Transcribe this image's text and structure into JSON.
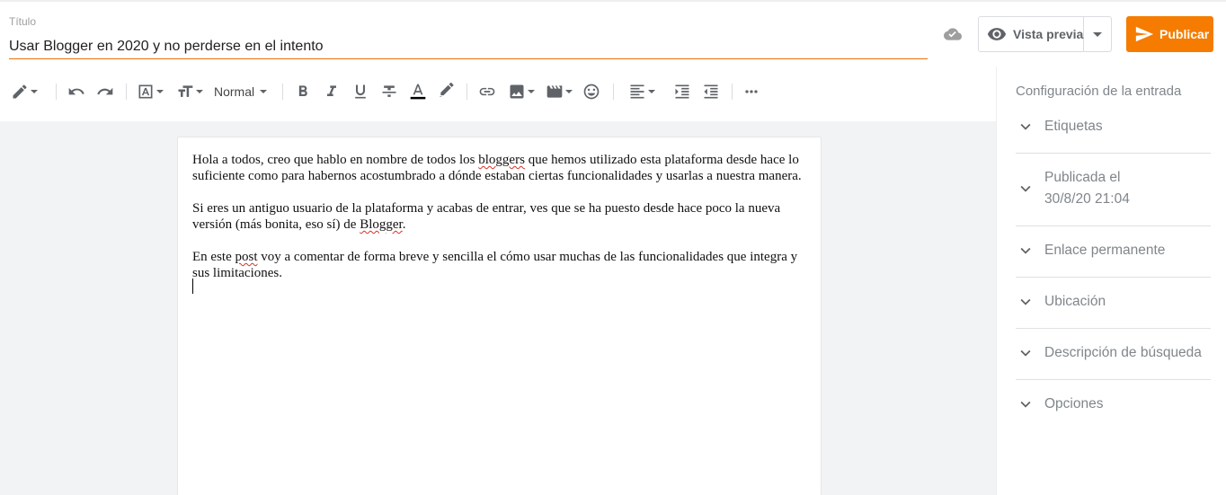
{
  "post": {
    "title_label": "Título",
    "title_value": "Usar Blogger en 2020 y no perderse en el intento"
  },
  "header": {
    "preview_label": "Vista previa",
    "publish_label": "Publicar"
  },
  "toolbar": {
    "format_label": "Normal"
  },
  "content": {
    "p1_a": " Hola a todos, creo que hablo en nombre de todos los ",
    "p1_b": "bloggers",
    "p1_c": " que hemos utilizado esta plataforma desde hace lo suficiente como para habernos acostumbrado a dónde estaban ciertas funcionalidades y usarlas a nuestra manera.",
    "p2_a": "Si eres un antiguo usuario de la plataforma y acabas de entrar, ves que se ha puesto desde hace poco la nueva versión (más bonita, eso sí) de ",
    "p2_b": "Blogger",
    "p2_c": ".",
    "p3_a": "En este ",
    "p3_b": "post",
    "p3_c": " voy a comentar de forma breve y sencilla el cómo usar muchas de las funcionalidades que integra y sus limitaciones."
  },
  "sidebar": {
    "title": "Configuración de la entrada",
    "items": [
      {
        "label": "Etiquetas"
      },
      {
        "label": "Publicada el",
        "label2": "30/8/20 21:04"
      },
      {
        "label": "Enlace permanente"
      },
      {
        "label": "Ubicación"
      },
      {
        "label": "Descripción de búsqueda"
      },
      {
        "label": "Opciones"
      }
    ]
  },
  "colors": {
    "accent": "#f57c00",
    "icon": "#5f6368",
    "sidebar_text": "#80868b"
  }
}
